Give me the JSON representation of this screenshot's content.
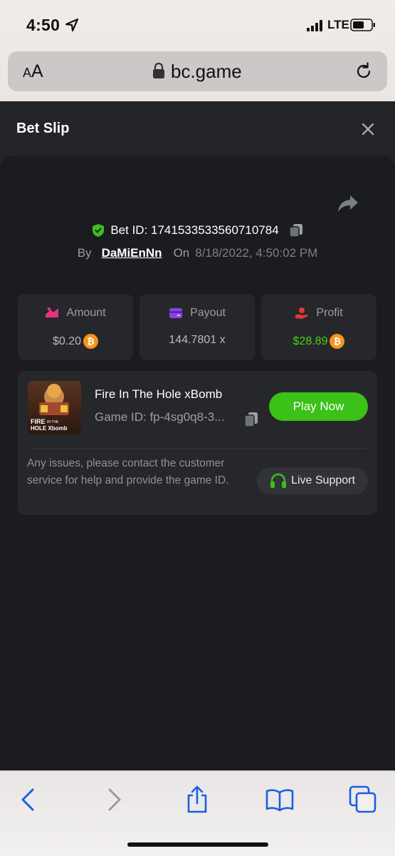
{
  "status_bar": {
    "time": "4:50",
    "network": "LTE"
  },
  "url_bar": {
    "aa_small": "A",
    "aa_big": "A",
    "domain": "bc.game"
  },
  "bet_slip": {
    "title": "Bet Slip",
    "bet_id": "Bet ID: 1741533533560710784",
    "by_label": "By",
    "user": "DaMiEnNn",
    "on_label": "On",
    "datetime": "8/18/2022, 4:50:02 PM",
    "stats": [
      {
        "label": "Amount",
        "value": "$0.20",
        "icon": "amount-icon"
      },
      {
        "label": "Payout",
        "value": "144.7801 x",
        "icon": "wallet-icon"
      },
      {
        "label": "Profit",
        "value": "$28.89",
        "icon": "profit-icon"
      }
    ],
    "game": {
      "name": "Fire In The Hole xBomb",
      "id": "Game ID: fp-4sg0q8-3...",
      "thumb_line1": "FIRE",
      "thumb_small": "IN THE",
      "thumb_line2": "HOLE Xbomb",
      "play_label": "Play Now"
    },
    "issues_text": "Any issues, please contact the customer service for help and provide the game ID.",
    "support_label": "Live Support"
  },
  "colors": {
    "accent_green": "#3bc117",
    "profit_green": "#4ad119",
    "btc_orange": "#f7931a"
  },
  "toolbar_icons": [
    "back-icon",
    "forward-icon",
    "share-icon",
    "bookmarks-icon",
    "tabs-icon"
  ]
}
